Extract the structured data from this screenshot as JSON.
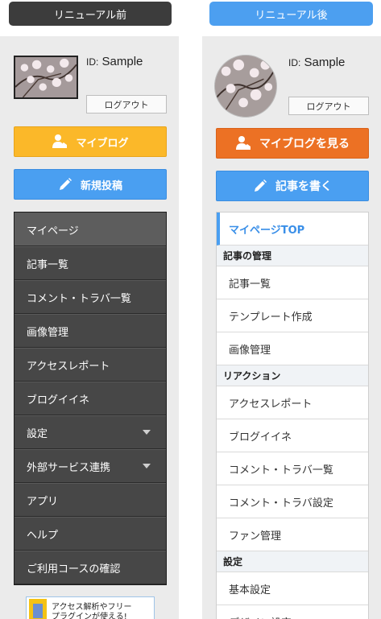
{
  "titles": {
    "before": "リニューアル前",
    "after": "リニューアル後"
  },
  "before": {
    "user": {
      "id_label": "ID:",
      "id_value": "Sample"
    },
    "logout_label": "ログアウト",
    "myblog_label": "マイブログ",
    "newpost_label": "新規投稿",
    "menu": [
      {
        "label": "マイページ"
      },
      {
        "label": "記事一覧"
      },
      {
        "label": "コメント・トラバ一覧"
      },
      {
        "label": "画像管理"
      },
      {
        "label": "アクセスレポート"
      },
      {
        "label": "ブログイイネ"
      },
      {
        "label": "設定"
      },
      {
        "label": "外部サービス連携"
      },
      {
        "label": "アプリ"
      },
      {
        "label": "ヘルプ"
      },
      {
        "label": "ご利用コースの確認"
      }
    ],
    "banner": {
      "line1": "アクセス解析やフリー",
      "line2": "プラグインが使える!"
    }
  },
  "after": {
    "user": {
      "id_label": "ID:",
      "id_value": "Sample"
    },
    "logout_label": "ログアウト",
    "myblog_label": "マイブログを見る",
    "write_label": "記事を書く",
    "menu": {
      "top": "マイページTOP",
      "section1": "記事の管理",
      "s1_items": [
        "記事一覧",
        "テンプレート作成",
        "画像管理"
      ],
      "section2": "リアクション",
      "s2_items": [
        "アクセスレポート",
        "ブログイイネ",
        "コメント・トラバ一覧",
        "コメント・トラバ設定",
        "ファン管理"
      ],
      "section3": "設定",
      "s3_items": [
        "基本設定",
        "デザイン設定"
      ]
    }
  },
  "colors": {
    "before_title": "#3c3c3c",
    "after_title": "#4c9ff0",
    "myblog_before": "#fbb829",
    "myblog_after": "#ec7124",
    "post_blue": "#4a9ff1"
  }
}
